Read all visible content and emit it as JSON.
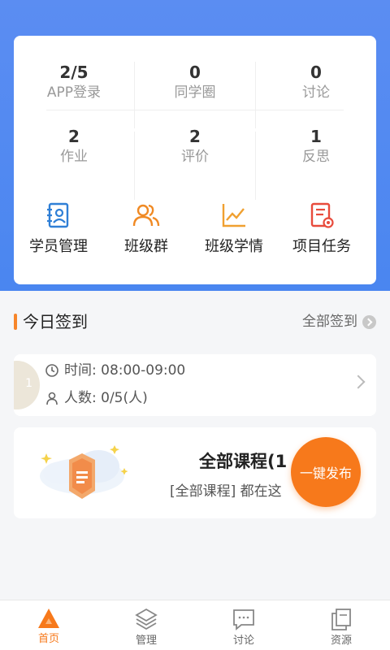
{
  "colors": {
    "brand_blue": "#4a86f0",
    "accent_orange": "#f7791b"
  },
  "stats": [
    {
      "value": "2/5",
      "label": "APP登录"
    },
    {
      "value": "0",
      "label": "同学圈"
    },
    {
      "value": "0",
      "label": "讨论"
    },
    {
      "value": "2",
      "label": "作业"
    },
    {
      "value": "2",
      "label": "评价"
    },
    {
      "value": "1",
      "label": "反思"
    }
  ],
  "quick_actions": [
    {
      "label": "学员管理",
      "icon": "contact-book-icon"
    },
    {
      "label": "班级群",
      "icon": "group-users-icon"
    },
    {
      "label": "班级学情",
      "icon": "line-chart-icon"
    },
    {
      "label": "项目任务",
      "icon": "task-settings-icon"
    }
  ],
  "today_checkin": {
    "title": "今日签到",
    "all_link": "全部签到",
    "badge": "1",
    "time_text": "时间: 08:00-09:00",
    "count_text": "人数: 0/5(人)"
  },
  "course": {
    "title": "全部课程(1",
    "subtitle": "[全部课程] 都在这"
  },
  "fab_label": "一键发布",
  "tabs": [
    {
      "label": "首页",
      "icon": "home-triangle-icon",
      "active": true
    },
    {
      "label": "管理",
      "icon": "layers-icon",
      "active": false
    },
    {
      "label": "讨论",
      "icon": "chat-icon",
      "active": false
    },
    {
      "label": "资源",
      "icon": "files-icon",
      "active": false
    }
  ]
}
